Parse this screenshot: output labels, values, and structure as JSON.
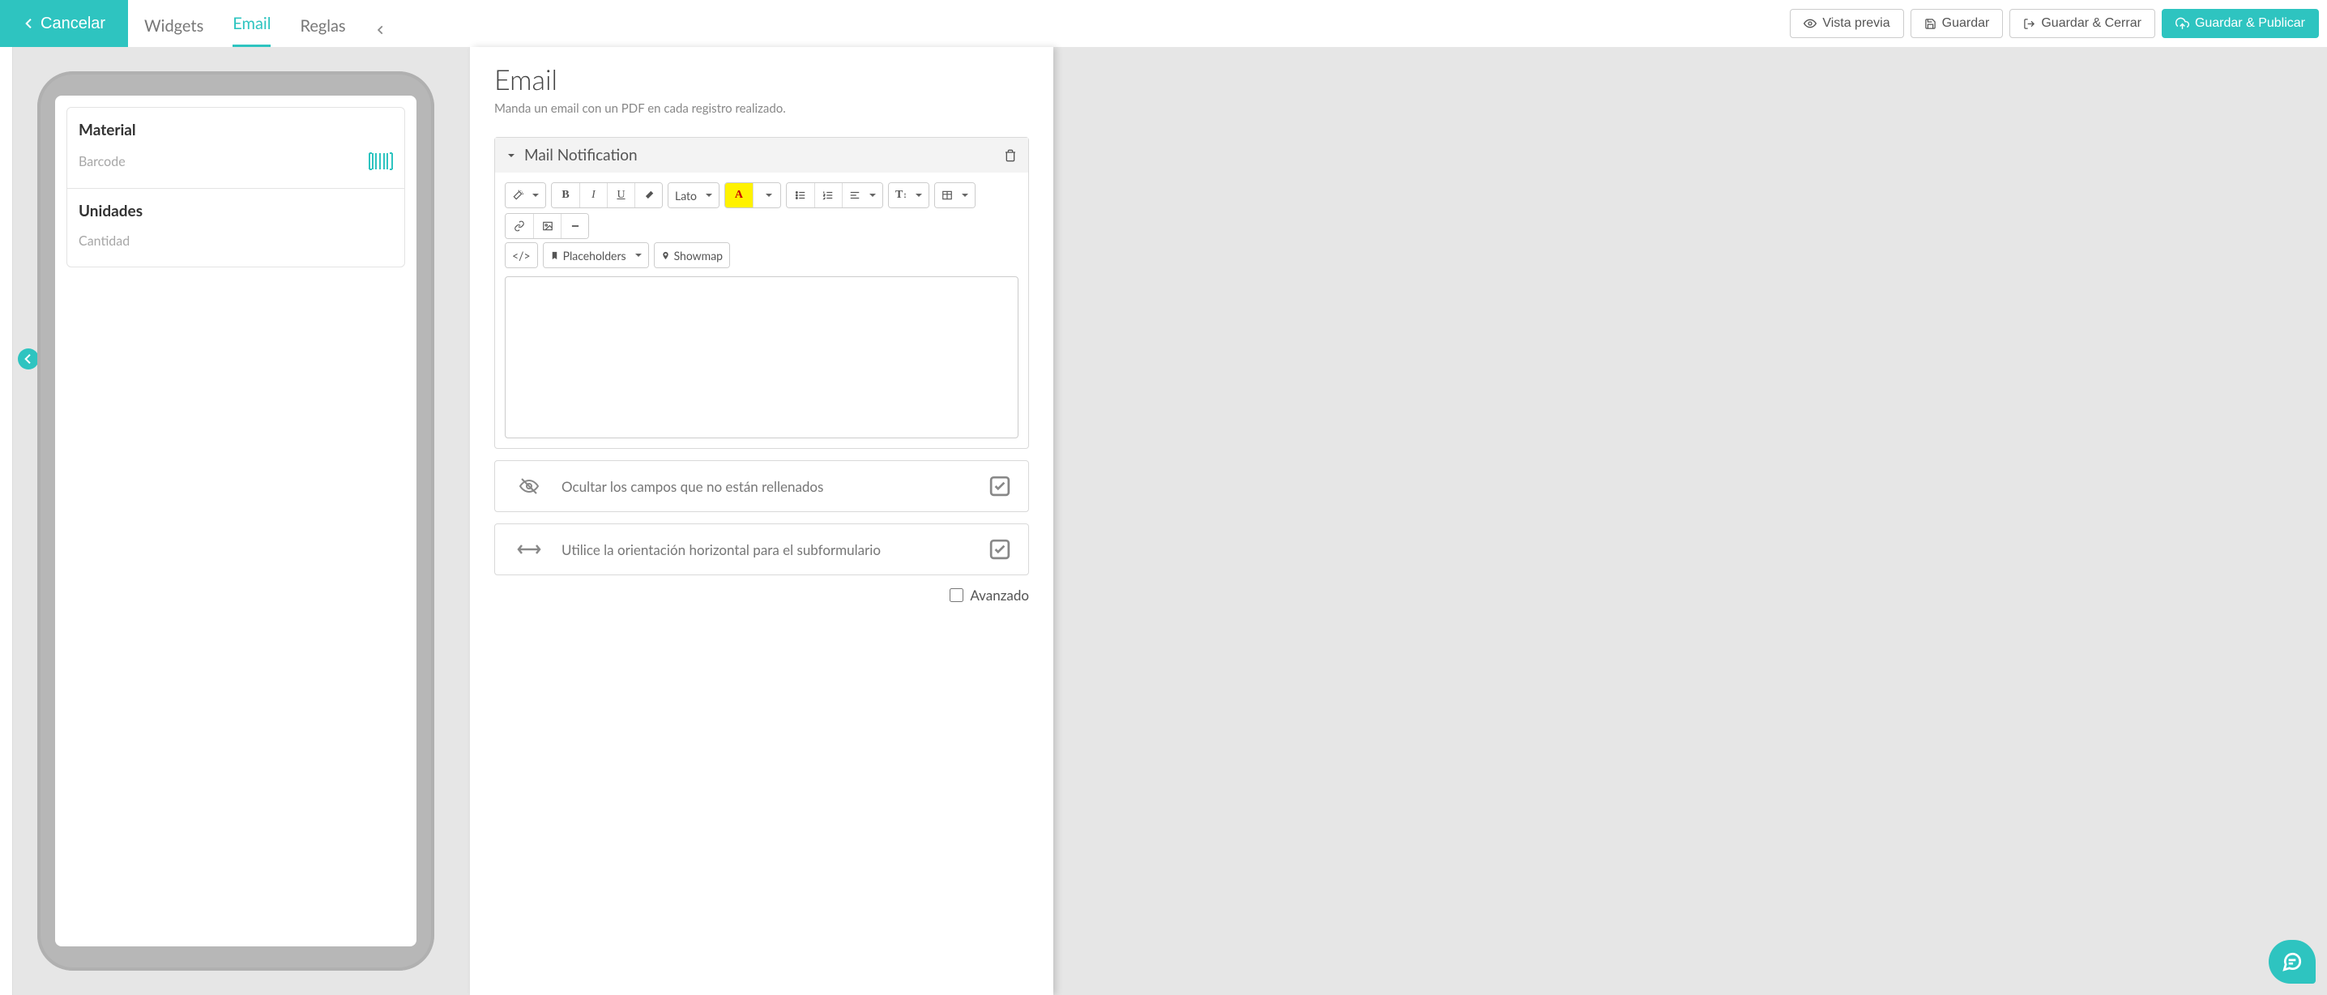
{
  "header": {
    "cancel": "Cancelar",
    "tabs": {
      "widgets": "Widgets",
      "email": "Email",
      "rules": "Reglas"
    },
    "buttons": {
      "preview": "Vista previa",
      "save": "Guardar",
      "save_close": "Guardar & Cerrar",
      "save_publish": "Guardar & Publicar"
    }
  },
  "form_preview": {
    "sections": [
      {
        "title": "Material",
        "field": "Barcode"
      },
      {
        "title": "Unidades",
        "field": "Cantidad"
      }
    ]
  },
  "main": {
    "title": "Email",
    "subtitle": "Manda un email con un PDF en cada registro realizado."
  },
  "panel": {
    "title": "Mail Notification",
    "toolbar": {
      "font": "Lato",
      "placeholders": "Placeholders",
      "showmap": "Showmap"
    }
  },
  "options": {
    "hide_empty": "Ocultar los campos que no están rellenados",
    "horizontal": "Utilice la orientación horizontal para el subformulario",
    "advanced": "Avanzado"
  }
}
